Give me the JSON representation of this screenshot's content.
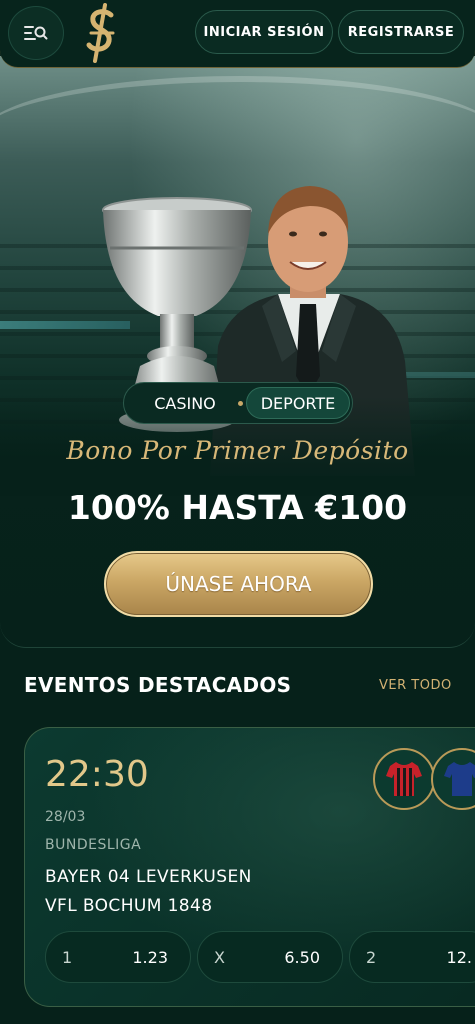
{
  "header": {
    "login_label": "INICIAR SESIÓN",
    "register_label": "REGISTRARSE",
    "menu_icon": "menu-search-icon",
    "logo_icon": "dollar-s-logo"
  },
  "hero": {
    "toggle": {
      "options": [
        {
          "label": "CASINO",
          "active": false
        },
        {
          "label": "DEPORTE",
          "active": true
        }
      ]
    },
    "promo_title": "Bono Por Primer Depósito",
    "promo_amount": "100% HASTA €100",
    "cta_label": "ÚNASE AHORA"
  },
  "events": {
    "title": "EVENTOS DESTACADOS",
    "see_all_label": "VER TODO",
    "items": [
      {
        "time": "22:30",
        "date": "28/03",
        "league": "BUNDESLIGA",
        "team1": "BAYER 04 LEVERKUSEN",
        "team2": "VFL BOCHUM 1848",
        "odds": [
          {
            "label": "1",
            "value": "1.23"
          },
          {
            "label": "X",
            "value": "6.50"
          },
          {
            "label": "2",
            "value": "12."
          }
        ]
      }
    ]
  },
  "colors": {
    "background": "#06211a",
    "gold": "#d2b273",
    "cta_gold": "#cba765",
    "card_border": "#3a5f45"
  }
}
